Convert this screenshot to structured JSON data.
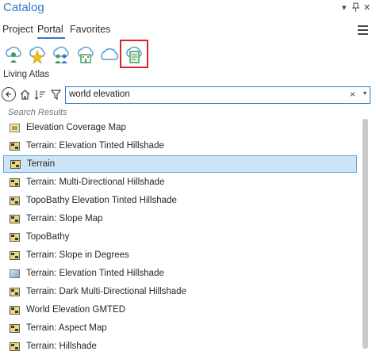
{
  "window": {
    "title": "Catalog",
    "dropdown_glyph": "▾",
    "pin_glyph": "ᵠ",
    "close_glyph": "✕"
  },
  "tabs": [
    {
      "label": "Project",
      "active": false
    },
    {
      "label": "Portal",
      "active": true
    },
    {
      "label": "Favorites",
      "active": false
    }
  ],
  "portal_icons": [
    {
      "name": "my-content-icon",
      "selected": false
    },
    {
      "name": "favorites-cloud-icon",
      "selected": false
    },
    {
      "name": "groups-cloud-icon",
      "selected": false
    },
    {
      "name": "organization-cloud-icon",
      "selected": false
    },
    {
      "name": "arcgis-online-cloud-icon",
      "selected": false
    },
    {
      "name": "living-atlas-icon",
      "selected": true
    }
  ],
  "section_label": "Living Atlas",
  "search": {
    "value": "world elevation",
    "clear_glyph": "×",
    "dropdown_glyph": "▾"
  },
  "results_header": "Search Results",
  "results": [
    {
      "label": "Elevation Coverage Map",
      "icon": "map",
      "selected": false
    },
    {
      "label": "Terrain: Elevation Tinted Hillshade",
      "icon": "tile",
      "selected": false
    },
    {
      "label": "Terrain",
      "icon": "tile",
      "selected": true
    },
    {
      "label": "Terrain: Multi-Directional Hillshade",
      "icon": "tile",
      "selected": false
    },
    {
      "label": "TopoBathy Elevation Tinted Hillshade",
      "icon": "tile",
      "selected": false
    },
    {
      "label": "Terrain: Slope Map",
      "icon": "tile",
      "selected": false
    },
    {
      "label": "TopoBathy",
      "icon": "tile",
      "selected": false
    },
    {
      "label": "Terrain: Slope in Degrees",
      "icon": "tile",
      "selected": false
    },
    {
      "label": "Terrain: Elevation Tinted Hillshade",
      "icon": "image",
      "selected": false
    },
    {
      "label": "Terrain: Dark Multi-Directional Hillshade",
      "icon": "tile",
      "selected": false
    },
    {
      "label": "World Elevation GMTED",
      "icon": "tile",
      "selected": false
    },
    {
      "label": "Terrain: Aspect Map",
      "icon": "tile",
      "selected": false
    },
    {
      "label": "Terrain: Hillshade",
      "icon": "tile",
      "selected": false
    }
  ],
  "colors": {
    "accent": "#2f79c7",
    "selection_bg": "#cde4f7",
    "selection_border": "#5ea2dc",
    "highlight_box": "#d7262b"
  }
}
